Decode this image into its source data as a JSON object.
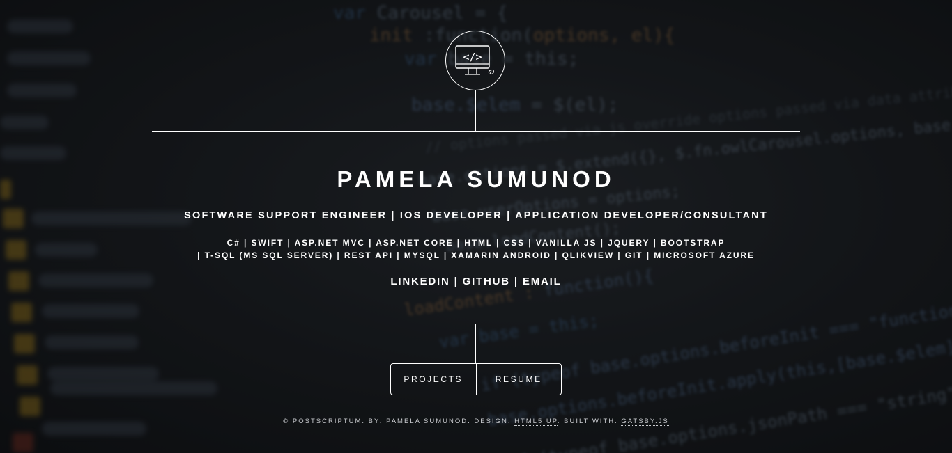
{
  "colors": {
    "background": "#15171a",
    "text": "#ffffff",
    "footer_text": "#c9cbcf",
    "code_keyword": "#4a7fb8",
    "code_string": "#c98a4a"
  },
  "logo": {
    "icon": "monitor-code-icon"
  },
  "header": {
    "name": "PAMELA SUMUNOD",
    "roles": "SOFTWARE SUPPORT ENGINEER | IOS DEVELOPER | APPLICATION DEVELOPER/CONSULTANT",
    "skills_line1": "C# | SWIFT | ASP.NET MVC | ASP.NET CORE | HTML | CSS | VANILLA JS | JQUERY | BOOTSTRAP",
    "skills_line2": "| T-SQL (MS SQL SERVER) | REST API | MYSQL | XAMARIN ANDROID | QLIKVIEW | GIT | MICROSOFT AZURE",
    "links": [
      {
        "label": "LINKEDIN"
      },
      {
        "label": "GITHUB"
      },
      {
        "label": "EMAIL"
      }
    ],
    "link_separator": "|"
  },
  "nav": {
    "projects_label": "PROJECTS",
    "resume_label": "RESUME"
  },
  "footer": {
    "prefix": "© POSTSCRIPTUM. BY: PAMELA SUMUNOD. DESIGN:",
    "design_link": "HTML5 UP",
    "middle": ". BUILT WITH:",
    "built_link": "GATSBY.JS"
  }
}
